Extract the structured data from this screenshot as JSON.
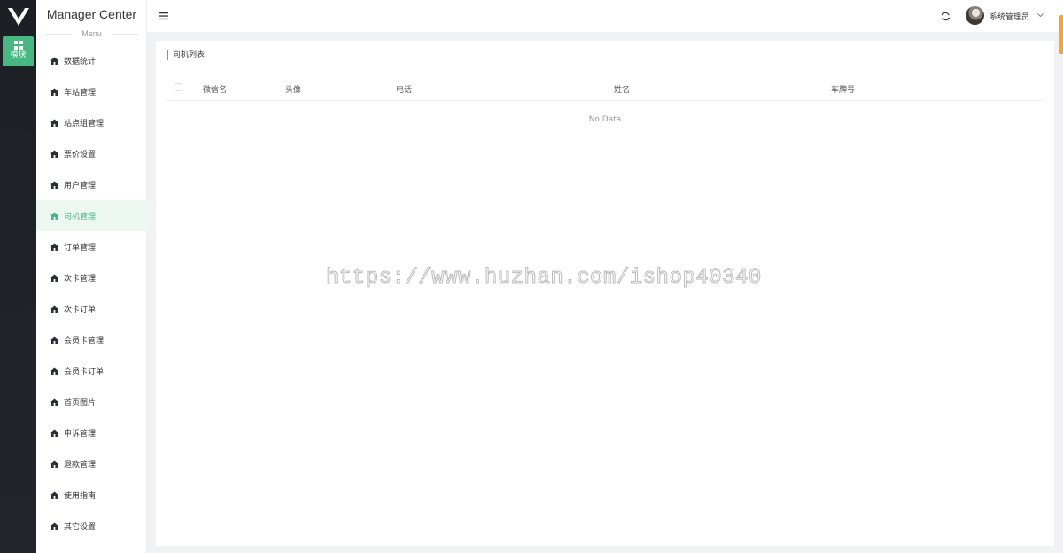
{
  "rail": {
    "module_label": "模块"
  },
  "sidebar": {
    "brand": "Manager Center",
    "menu_caption": "Menu",
    "items": [
      {
        "label": "数据统计"
      },
      {
        "label": "车站管理"
      },
      {
        "label": "站点组管理"
      },
      {
        "label": "票价设置"
      },
      {
        "label": "用户管理"
      },
      {
        "label": "司机管理",
        "active": true
      },
      {
        "label": "订单管理"
      },
      {
        "label": "次卡管理"
      },
      {
        "label": "次卡订单"
      },
      {
        "label": "会员卡管理"
      },
      {
        "label": "会员卡订单"
      },
      {
        "label": "首页图片"
      },
      {
        "label": "申诉管理"
      },
      {
        "label": "退款管理"
      },
      {
        "label": "使用指南"
      },
      {
        "label": "其它设置"
      }
    ]
  },
  "header": {
    "user_name": "系统管理员"
  },
  "main": {
    "title": "司机列表",
    "table": {
      "columns": [
        "微信名",
        "头像",
        "电话",
        "姓名",
        "车牌号"
      ],
      "rows": [],
      "empty_text": "No Data"
    }
  },
  "watermark": "https://www.huzhan.com/ishop40340",
  "colors": {
    "accent": "#48b883",
    "rail_bg": "#1c1f24",
    "active_bg": "#edf7f2",
    "side_tab": "#f3a53a"
  },
  "icons": {
    "menu_item": "home-icon",
    "header_toggle": "hamburger-icon",
    "header_refresh": "refresh-icon",
    "rail_module": "grid-icon"
  }
}
